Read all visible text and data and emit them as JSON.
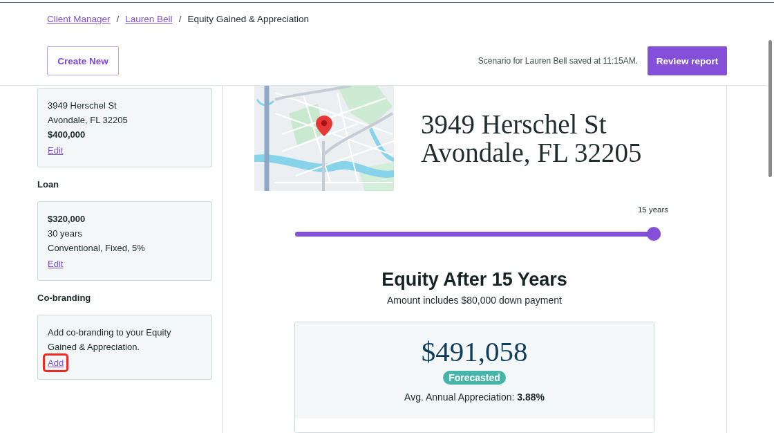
{
  "breadcrumb": [
    {
      "kind": "link",
      "label": "Client Manager"
    },
    {
      "kind": "separator",
      "label": "/"
    },
    {
      "kind": "link",
      "label": "Lauren Bell"
    },
    {
      "kind": "separator",
      "label": "/"
    },
    {
      "kind": "current",
      "label": "Equity Gained & Appreciation"
    }
  ],
  "toolbar": {
    "create_button": "Create New",
    "save_status": "Scenario for Lauren Bell saved at 11:15AM.",
    "review_button": "Review report"
  },
  "sidebar": {
    "sections": [
      {
        "card": {
          "lines": [
            {
              "text": "3949 Herschel St",
              "bold": false
            },
            {
              "text": "Avondale, FL 32205",
              "bold": false
            },
            {
              "text": "$400,000",
              "bold": true
            }
          ],
          "link": {
            "label": "Edit",
            "highlighted": false
          }
        }
      },
      {
        "heading": "Loan",
        "card": {
          "lines": [
            {
              "text": "$320,000",
              "bold": true
            },
            {
              "text": "30 years",
              "bold": false
            },
            {
              "text": "Conventional, Fixed, 5%",
              "bold": false
            }
          ],
          "link": {
            "label": "Edit",
            "highlighted": false
          }
        }
      },
      {
        "heading": "Co-branding",
        "card": {
          "lines": [
            {
              "text": "Add co-branding to your Equity Gained & Appreciation.",
              "bold": false
            }
          ],
          "link": {
            "label": "Add",
            "highlighted": true
          }
        }
      }
    ]
  },
  "property": {
    "address_lines": [
      "3949 Herschel St",
      "Avondale, FL 32205"
    ]
  },
  "timeline": {
    "label": "15 years",
    "level": 1
  },
  "summary": {
    "title": "Equity After 15 Years",
    "subtitle": "Amount includes $80,000 down payment",
    "amount": "$491,058",
    "badge": "Forecasted",
    "appreciation": "Avg. Annual Appreciation: **3.88%**"
  }
}
